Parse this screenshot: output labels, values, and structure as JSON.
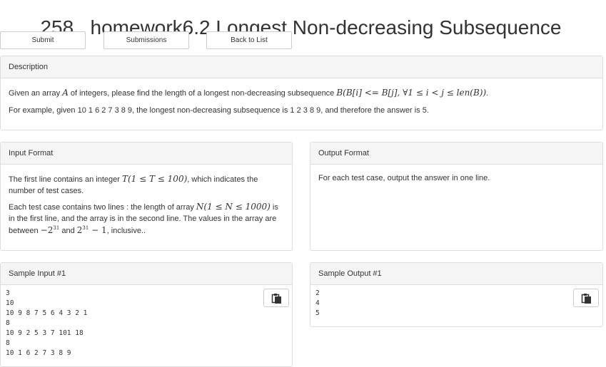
{
  "page": {
    "title": "258 . homework6.2 Longest Non-decreasing Subsequence"
  },
  "toolbar": {
    "submit_label": "Submit",
    "submissions_label": "Submissions",
    "back_label": "Back to List"
  },
  "description": {
    "heading": "Description",
    "line1_prefix": "Given an array ",
    "line1_var": "A",
    "line1_middle": " of integers, please find the length of a longest non-decreasing subsequence ",
    "line1_math": "B(B[i] <= B[j], ∀1 ≤ i < j ≤ len(B))",
    "line1_suffix": ".",
    "line2": "For example, given 10 1 6 2 7 3 8 9, the longest non-decreasing subsequence is 1 2 3 8 9, and therefore the answer is 5."
  },
  "input_format": {
    "heading": "Input Format",
    "p1_prefix": "The first line contains an integer ",
    "p1_math": "T(1 ≤ T ≤ 100)",
    "p1_suffix_a": ", which indicates the",
    "p1_suffix_b": "number of test cases.",
    "p2_prefix": "Each test case contains two lines : the length of array ",
    "p2_math": "N(1 ≤ N ≤ 1000)",
    "p2_suffix": " is",
    "p2_line2": "in the first line, and the array is in the second line. The values in the array are",
    "p2_line3_prefix": "between ",
    "p2_low_base": "−2",
    "p2_low_exp": "31",
    "p2_and": " and ",
    "p2_high_base": "2",
    "p2_high_exp": "31",
    "p2_high_tail": " − 1",
    "p2_end": ", inclusive.."
  },
  "output_format": {
    "heading": "Output Format",
    "text": "For each test case, output the answer in one line."
  },
  "sample_input": {
    "heading": "Sample Input #1",
    "content": "3\n10\n10 9 8 7 5 6 4 3 2 1\n8\n10 9 2 5 3 7 101 18\n8\n10 1 6 2 7 3 8 9"
  },
  "sample_output": {
    "heading": "Sample Output #1",
    "content": "2\n4\n5"
  },
  "icons": {
    "copy": "copy-icon"
  },
  "colors": {
    "heading_bg": "#f5f5f5",
    "border": "#dddddd",
    "text": "#333333"
  }
}
